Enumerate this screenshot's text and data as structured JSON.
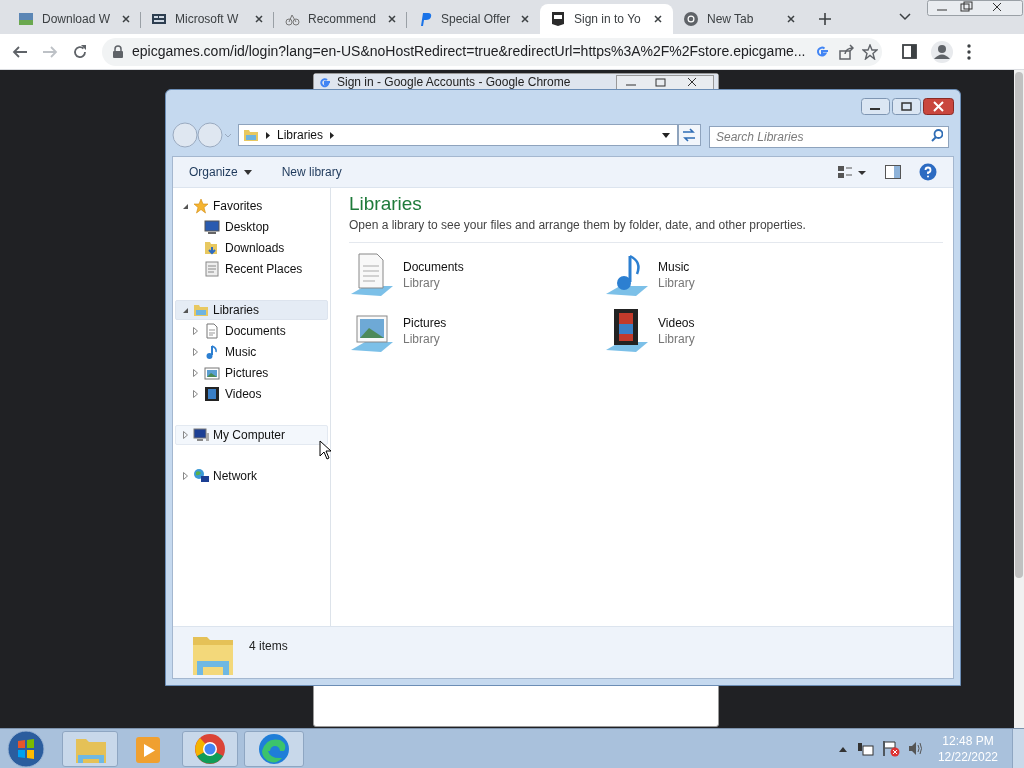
{
  "browser": {
    "tabs": [
      {
        "title": "Download W",
        "selected": false
      },
      {
        "title": "Microsoft W",
        "selected": false
      },
      {
        "title": "Recommend",
        "selected": false
      },
      {
        "title": "Special Offer",
        "selected": false
      },
      {
        "title": "Sign in to Yo",
        "selected": true
      },
      {
        "title": "New Tab",
        "selected": false
      }
    ],
    "url": "epicgames.com/id/login?lang=en-US&noHostRedirect=true&redirectUrl=https%3A%2F%2Fstore.epicgame..."
  },
  "popup_window": {
    "title": "Sign in - Google Accounts - Google Chrome"
  },
  "explorer": {
    "breadcrumb": [
      "Libraries"
    ],
    "search": {
      "placeholder": "Search Libraries"
    },
    "toolbar": [
      "Organize",
      "New library"
    ],
    "nav": [
      {
        "label": "Favorites",
        "expanded": true,
        "selected": false,
        "hovered": false,
        "children": [
          {
            "label": "Desktop"
          },
          {
            "label": "Downloads"
          },
          {
            "label": "Recent Places"
          }
        ]
      },
      {
        "label": "Libraries",
        "expanded": true,
        "selected": true,
        "hovered": false,
        "children": [
          {
            "label": "Documents"
          },
          {
            "label": "Music"
          },
          {
            "label": "Pictures"
          },
          {
            "label": "Videos"
          }
        ]
      },
      {
        "label": "My Computer",
        "expanded": false,
        "selected": false,
        "hovered": true
      },
      {
        "label": "Network",
        "expanded": false,
        "selected": false,
        "hovered": false
      }
    ],
    "heading": "Libraries",
    "description": "Open a library to see your files and arrange them by folder, date, and other properties.",
    "libraries": [
      {
        "name": "Documents",
        "type": "Library"
      },
      {
        "name": "Music",
        "type": "Library"
      },
      {
        "name": "Pictures",
        "type": "Library"
      },
      {
        "name": "Videos",
        "type": "Library"
      }
    ],
    "status": "4 items"
  },
  "taskbar": {
    "time": "12:48 PM",
    "date": "12/22/2022"
  }
}
